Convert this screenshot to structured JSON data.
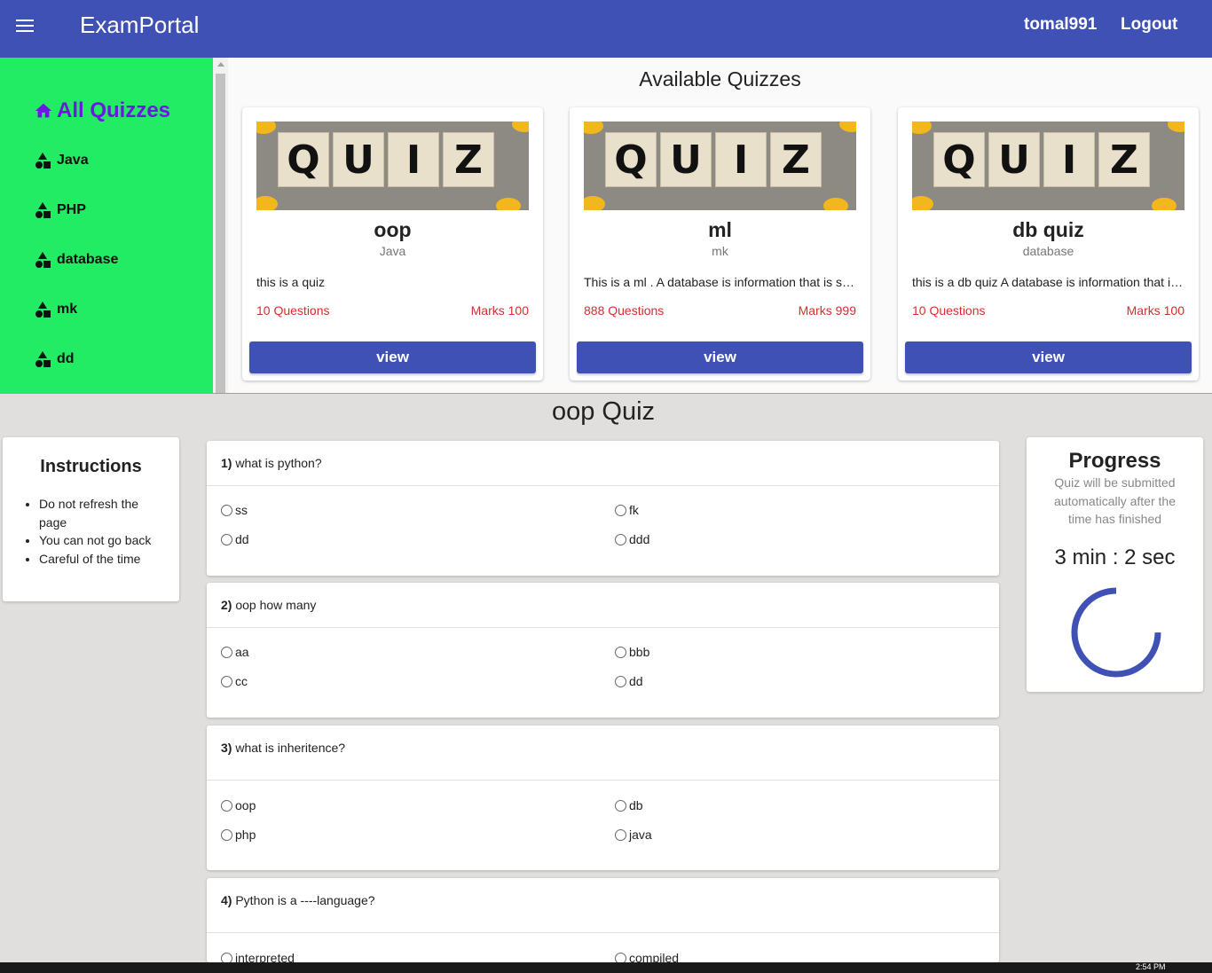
{
  "header": {
    "brand": "ExamPortal",
    "username": "tomal991",
    "logout": "Logout"
  },
  "sidebar": {
    "title": "All Quizzes",
    "items": [
      {
        "label": "Java"
      },
      {
        "label": "PHP"
      },
      {
        "label": "database"
      },
      {
        "label": "mk"
      },
      {
        "label": "dd"
      }
    ]
  },
  "quizzes": {
    "title": "Available Quizzes",
    "image_text": [
      "Q",
      "U",
      "I",
      "Z"
    ],
    "cards": [
      {
        "title": "oop",
        "category": "Java",
        "description": "this is a quiz",
        "questions": "10 Questions",
        "marks": "Marks 100",
        "button": "view"
      },
      {
        "title": "ml",
        "category": "mk",
        "description": "This is a ml . A database is information that is set up for easy access",
        "questions": "888 Questions",
        "marks": "Marks 999",
        "button": "view"
      },
      {
        "title": "db quiz",
        "category": "database",
        "description": "this is a db quiz A database is information that is set up for easy access",
        "questions": "10 Questions",
        "marks": "Marks 100",
        "button": "view"
      }
    ]
  },
  "quiz": {
    "heading": "oop Quiz",
    "instructions": {
      "title": "Instructions",
      "items": [
        "Do not refresh the page",
        "You can not go back",
        "Careful of the time"
      ]
    },
    "questions": [
      {
        "num": "1)",
        "text": "what is python?",
        "options": [
          "ss",
          "fk",
          "dd",
          "ddd"
        ]
      },
      {
        "num": "2)",
        "text": "oop how many",
        "options": [
          "aa",
          "bbb",
          "cc",
          "dd"
        ]
      },
      {
        "num": "3)",
        "text": "what is inheritence?",
        "options": [
          "oop",
          "db",
          "php",
          "java"
        ]
      },
      {
        "num": "4)",
        "text": "Python is a ----language?",
        "options": [
          "interpreted",
          "compiled"
        ]
      }
    ],
    "progress": {
      "title": "Progress",
      "note": "Quiz will be submitted automatically after the time has finished",
      "timer": "3 min : 2 sec",
      "fraction_remaining": 0.75
    }
  },
  "colors": {
    "primary": "#3f51b5",
    "sidebar": "#22eb64",
    "accent": "#6a1ae0",
    "danger": "#d32f2f"
  },
  "taskbar": {
    "time": "2:54 PM"
  }
}
